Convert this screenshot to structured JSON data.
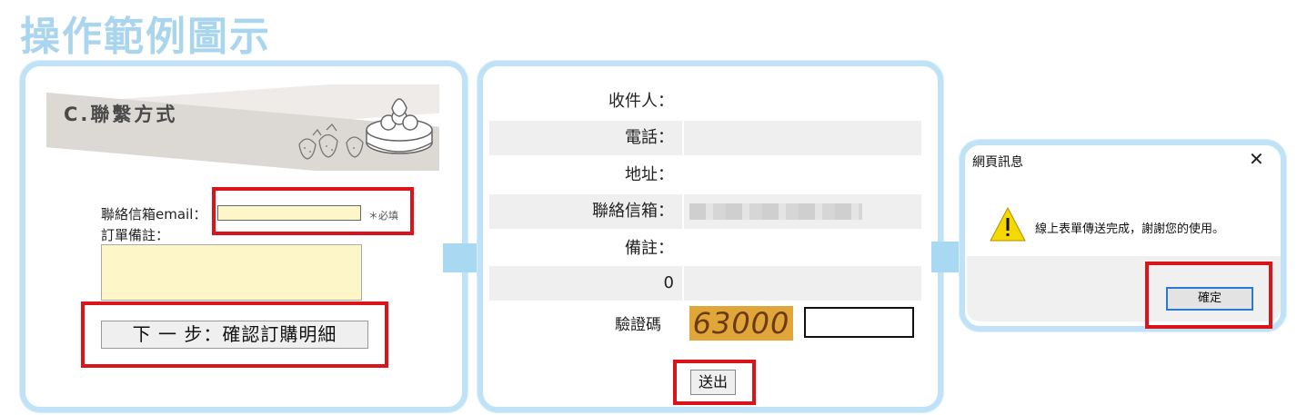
{
  "page_title": "操作範例圖示",
  "step1": {
    "section_heading": "C.聯繫方式",
    "email_label": "聯絡信箱email：",
    "required_note": "＊必填",
    "note_label": "訂單備註：",
    "next_button": "下 一 步：確認訂購明細"
  },
  "step2": {
    "rows": [
      {
        "label": "收件人："
      },
      {
        "label": "電話："
      },
      {
        "label": "地址："
      },
      {
        "label": "聯絡信箱："
      },
      {
        "label": "備註："
      },
      {
        "label": "0"
      }
    ],
    "captcha_label": "驗證碼",
    "captcha_value": "63000",
    "send_button": "送出"
  },
  "step3": {
    "dialog_title": "網頁訊息",
    "close_symbol": "✕",
    "message": "線上表單傳送完成，謝謝您的使用。",
    "ok_button": "確定"
  },
  "colors": {
    "title": "#a9d5ee",
    "panel_border": "#bfe2f6",
    "highlight_box": "#d9141b",
    "input_fill": "#fdf6c9",
    "arrow": "#a8d8f2"
  },
  "icons": [
    "cake-icon",
    "strawberry-icon",
    "warning-icon",
    "close-icon",
    "arrow-right-icon"
  ]
}
